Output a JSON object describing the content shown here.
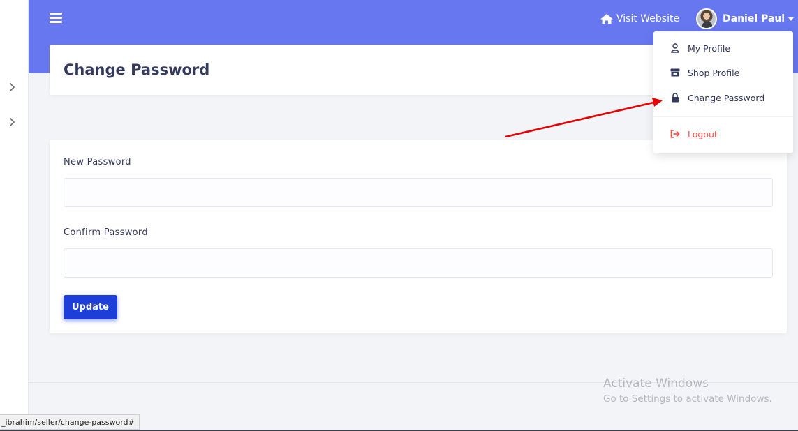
{
  "topbar": {
    "visit_website_label": "Visit Website",
    "user_name": "Daniel Paul",
    "accent_color": "#6777ef"
  },
  "page": {
    "title": "Change Password"
  },
  "form": {
    "new_password_label": "New Password",
    "new_password_value": "",
    "confirm_password_label": "Confirm Password",
    "confirm_password_value": "",
    "update_label": "Update",
    "button_color": "#1d3fd8"
  },
  "dropdown": {
    "items": [
      {
        "label": "My Profile",
        "icon": "user-icon"
      },
      {
        "label": "Shop Profile",
        "icon": "store-icon"
      },
      {
        "label": "Change Password",
        "icon": "lock-icon"
      },
      {
        "label": "Logout",
        "icon": "logout-icon",
        "color": "#fc544b"
      }
    ]
  },
  "sidebar": {
    "icons": [
      "chevron-right-icon",
      "chevron-right-icon"
    ]
  },
  "watermark": {
    "line1": "Activate Windows",
    "line2": "Go to Settings to activate Windows."
  },
  "status_bar": {
    "url": "_ibrahim/seller/change-password#"
  }
}
